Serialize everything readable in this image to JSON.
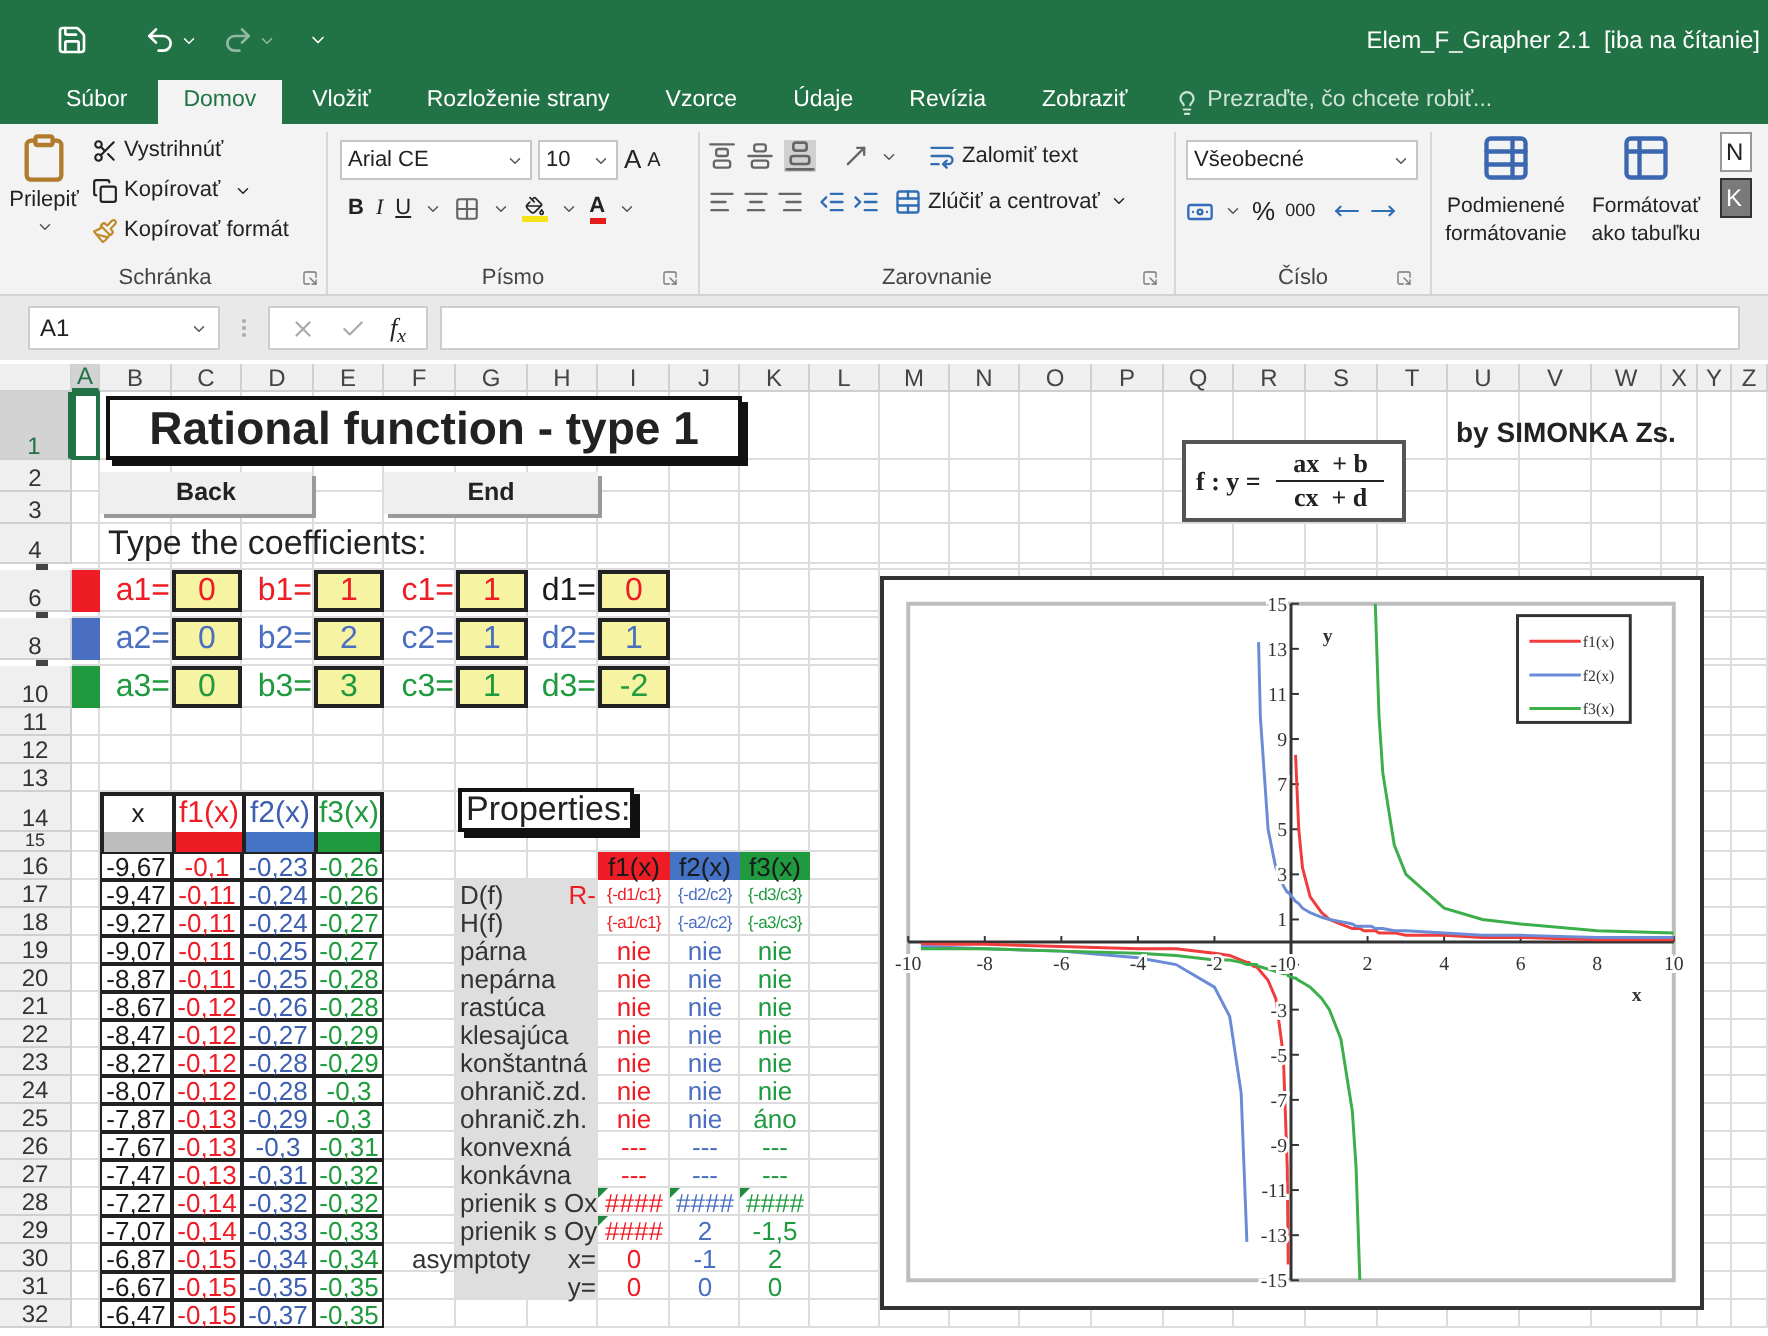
{
  "window": {
    "title": "Elem_F_Grapher 2.1  [iba na čítanie]"
  },
  "ribbon_tabs": [
    {
      "label": "Súbor",
      "selected": false
    },
    {
      "label": "Domov",
      "selected": true
    },
    {
      "label": "Vložiť",
      "selected": false
    },
    {
      "label": "Rozloženie strany",
      "selected": false
    },
    {
      "label": "Vzorce",
      "selected": false
    },
    {
      "label": "Údaje",
      "selected": false
    },
    {
      "label": "Revízia",
      "selected": false
    },
    {
      "label": "Zobraziť",
      "selected": false
    }
  ],
  "tell_me": {
    "placeholder": "Prezraďte, čo chcete robiť..."
  },
  "clipboard": {
    "label": "Schránka",
    "paste": "Prilepiť",
    "cut": "Vystrihnúť",
    "copy": "Kopírovať",
    "format_painter": "Kopírovať formát"
  },
  "font": {
    "label": "Písmo",
    "name": "Arial CE",
    "size": "10",
    "grow": "A",
    "shrink": "A",
    "bold": "B",
    "italic": "I",
    "underline": "U",
    "font_color": "A"
  },
  "alignment": {
    "label": "Zarovnanie",
    "wrap_text": "Zalomiť text",
    "merge": "Zlúčiť a centrovať"
  },
  "number": {
    "label": "Číslo",
    "format": "Všeobecné",
    "percent": "%",
    "thousands": "000"
  },
  "styles": {
    "conditional": "Podmienené formátovanie",
    "as_table": "Formátovať ako tabuľku",
    "style_1": "N",
    "style_2": "K"
  },
  "formula_bar": {
    "name_box": "A1",
    "fx": "f$_{x}$"
  },
  "sheet": {
    "columns": [
      {
        "label": "A",
        "selected": true
      },
      {
        "label": "B",
        "selected": false
      },
      {
        "label": "C",
        "selected": false
      },
      {
        "label": "D",
        "selected": false
      },
      {
        "label": "E",
        "selected": false
      },
      {
        "label": "F",
        "selected": false
      },
      {
        "label": "G",
        "selected": false
      },
      {
        "label": "H",
        "selected": false
      },
      {
        "label": "I",
        "selected": false
      },
      {
        "label": "J",
        "selected": false
      },
      {
        "label": "K",
        "selected": false
      },
      {
        "label": "L",
        "selected": false
      },
      {
        "label": "M",
        "selected": false
      },
      {
        "label": "N",
        "selected": false
      },
      {
        "label": "O",
        "selected": false
      },
      {
        "label": "P",
        "selected": false
      },
      {
        "label": "Q",
        "selected": false
      },
      {
        "label": "R",
        "selected": false
      },
      {
        "label": "S",
        "selected": false
      },
      {
        "label": "T",
        "selected": false
      },
      {
        "label": "U",
        "selected": false
      },
      {
        "label": "V",
        "selected": false
      },
      {
        "label": "W",
        "selected": false
      },
      {
        "label": "X",
        "selected": false
      },
      {
        "label": "Y",
        "selected": false
      },
      {
        "label": "Z",
        "selected": false
      }
    ],
    "rows": [
      {
        "label": "1",
        "selected": true,
        "collapsed": false
      },
      {
        "label": "2",
        "selected": false,
        "collapsed": false
      },
      {
        "label": "3",
        "selected": false,
        "collapsed": false
      },
      {
        "label": "4",
        "selected": false,
        "collapsed": false
      },
      {
        "selected": false,
        "collapsed": true
      },
      {
        "label": "6",
        "selected": false,
        "collapsed": false
      },
      {
        "selected": false,
        "collapsed": true
      },
      {
        "label": "8",
        "selected": false,
        "collapsed": false
      },
      {
        "selected": false,
        "collapsed": true
      },
      {
        "label": "10",
        "selected": false,
        "collapsed": false
      },
      {
        "label": "11",
        "selected": false,
        "collapsed": false
      },
      {
        "label": "12",
        "selected": false,
        "collapsed": false
      },
      {
        "label": "13",
        "selected": false,
        "collapsed": false
      },
      {
        "label": "14",
        "selected": false,
        "collapsed": false
      },
      {
        "label": "15",
        "selected": false,
        "collapsed": false
      },
      {
        "label": "16",
        "selected": false,
        "collapsed": false
      },
      {
        "label": "17",
        "selected": false,
        "collapsed": false
      },
      {
        "label": "18",
        "selected": false,
        "collapsed": false
      },
      {
        "label": "19",
        "selected": false,
        "collapsed": false
      },
      {
        "label": "20",
        "selected": false,
        "collapsed": false
      },
      {
        "label": "21",
        "selected": false,
        "collapsed": false
      },
      {
        "label": "22",
        "selected": false,
        "collapsed": false
      },
      {
        "label": "23",
        "selected": false,
        "collapsed": false
      },
      {
        "label": "24",
        "selected": false,
        "collapsed": false
      },
      {
        "label": "25",
        "selected": false,
        "collapsed": false
      },
      {
        "label": "26",
        "selected": false,
        "collapsed": false
      },
      {
        "label": "27",
        "selected": false,
        "collapsed": false
      },
      {
        "label": "28",
        "selected": false,
        "collapsed": false
      },
      {
        "label": "29",
        "selected": false,
        "collapsed": false
      },
      {
        "label": "30",
        "selected": false,
        "collapsed": false
      },
      {
        "label": "31",
        "selected": false,
        "collapsed": false
      },
      {
        "label": "32",
        "selected": false,
        "collapsed": false
      }
    ]
  },
  "title": "Rational function - type 1",
  "buttons": [
    "Back",
    "End"
  ],
  "prompt": "Type the coefficients:",
  "functions": [
    {
      "color": "#ee1c25",
      "terms": [
        {
          "label": "a1=",
          "value": "0"
        },
        {
          "label": "b1=",
          "value": "1"
        },
        {
          "label": "c1=",
          "value": "1"
        },
        {
          "label": "d1=",
          "value": "0",
          "color": "#1a1a1a"
        }
      ]
    },
    {
      "color": "#4a6fc0",
      "terms": [
        {
          "label": "a2=",
          "value": "0"
        },
        {
          "label": "b2=",
          "value": "2"
        },
        {
          "label": "c2=",
          "value": "1"
        },
        {
          "label": "d2=",
          "value": "1"
        }
      ]
    },
    {
      "color": "#1f9a3e",
      "terms": [
        {
          "label": "a3=",
          "value": "0"
        },
        {
          "label": "b3=",
          "value": "3"
        },
        {
          "label": "c3=",
          "value": "1"
        },
        {
          "label": "d3=",
          "value": "-2"
        }
      ]
    }
  ],
  "formula": {
    "lhs": "f : y =",
    "numerator": "ax  + b",
    "denominator": "cx  + d"
  },
  "author": "by SIMONKA Zs.",
  "table": {
    "columns": [
      {
        "label": "x",
        "color": "#1a1a1a"
      },
      {
        "label": "f1(x)",
        "color": "#ee1c25"
      },
      {
        "label": "f2(x)",
        "color": "#3d5fb0"
      },
      {
        "label": "f3(x)",
        "color": "#1f9a3e"
      }
    ],
    "header_bars": [
      {
        "color": "#bdbdbd"
      },
      {
        "color": "#ee1c25"
      },
      {
        "color": "#4472c4"
      },
      {
        "color": "#1f9a3e"
      }
    ],
    "rows": [
      [
        "-9,67",
        "-0,1",
        "-0,23",
        "-0,26"
      ],
      [
        "-9,47",
        "-0,11",
        "-0,24",
        "-0,26"
      ],
      [
        "-9,27",
        "-0,11",
        "-0,24",
        "-0,27"
      ],
      [
        "-9,07",
        "-0,11",
        "-0,25",
        "-0,27"
      ],
      [
        "-8,87",
        "-0,11",
        "-0,25",
        "-0,28"
      ],
      [
        "-8,67",
        "-0,12",
        "-0,26",
        "-0,28"
      ],
      [
        "-8,47",
        "-0,12",
        "-0,27",
        "-0,29"
      ],
      [
        "-8,27",
        "-0,12",
        "-0,28",
        "-0,29"
      ],
      [
        "-8,07",
        "-0,12",
        "-0,28",
        "-0,3"
      ],
      [
        "-7,87",
        "-0,13",
        "-0,29",
        "-0,3"
      ],
      [
        "-7,67",
        "-0,13",
        "-0,3",
        "-0,31"
      ],
      [
        "-7,47",
        "-0,13",
        "-0,31",
        "-0,32"
      ],
      [
        "-7,27",
        "-0,14",
        "-0,32",
        "-0,32"
      ],
      [
        "-7,07",
        "-0,14",
        "-0,33",
        "-0,33"
      ],
      [
        "-6,87",
        "-0,15",
        "-0,34",
        "-0,34"
      ],
      [
        "-6,67",
        "-0,15",
        "-0,35",
        "-0,35"
      ],
      [
        "-6,47",
        "-0,15",
        "-0,37",
        "-0,35"
      ]
    ]
  },
  "properties": {
    "title": "Properties:",
    "headers": [
      {
        "label": "f1(x)",
        "color": "#ee1c25"
      },
      {
        "label": "f2(x)",
        "color": "#4472c4"
      },
      {
        "label": "f3(x)",
        "color": "#1f9a3e"
      }
    ],
    "rows": [
      {
        "kind": "formula",
        "label": "D(f)",
        "suffix": "R-",
        "values": [
          "{-d1/c1}",
          "{-d2/c2}",
          "{-d3/c3}"
        ]
      },
      {
        "kind": "formula",
        "label": "H(f)",
        "values": [
          "{-a1/c1}",
          "{-a2/c2}",
          "{-a3/c3}"
        ]
      },
      {
        "kind": "value",
        "label": "párna",
        "values": [
          "nie",
          "nie",
          "nie"
        ]
      },
      {
        "kind": "value",
        "label": "nepárna",
        "values": [
          "nie",
          "nie",
          "nie"
        ]
      },
      {
        "kind": "value",
        "label": "rastúca",
        "values": [
          "nie",
          "nie",
          "nie"
        ]
      },
      {
        "kind": "value",
        "label": "klesajúca",
        "values": [
          "nie",
          "nie",
          "nie"
        ]
      },
      {
        "kind": "value",
        "label": "konštantná",
        "values": [
          "nie",
          "nie",
          "nie"
        ]
      },
      {
        "kind": "value",
        "label": "ohranič.zd.",
        "values": [
          "nie",
          "nie",
          "nie"
        ]
      },
      {
        "kind": "value",
        "label": "ohranič.zh.",
        "values": [
          "nie",
          "nie",
          "áno"
        ]
      },
      {
        "kind": "value",
        "label": "konvexná",
        "values": [
          "---",
          "---",
          "---"
        ]
      },
      {
        "kind": "value",
        "label": "konkávna",
        "values": [
          "---",
          "---",
          "---"
        ]
      },
      {
        "kind": "value",
        "label": "prienik s Ox",
        "values": [
          "####",
          "####",
          "####"
        ],
        "flags": [
          true,
          true,
          true
        ]
      },
      {
        "kind": "value",
        "label": "prienik s Oy",
        "values": [
          "####",
          "2",
          "-1,5"
        ],
        "flags": [
          true,
          false,
          false
        ]
      },
      {
        "kind": "asymptote",
        "label": "asymptoty",
        "suffix": "x=",
        "values": [
          "0",
          "-1",
          "2"
        ]
      },
      {
        "kind": "value",
        "suffix": "y=",
        "values": [
          "0",
          "0",
          "0"
        ]
      }
    ]
  },
  "chart": {
    "chart_data": {
      "type": "line",
      "xlabel": "x",
      "ylabel": "y",
      "legend": "upper right",
      "xlim": [
        -10,
        10
      ],
      "ylim": [
        -15,
        15
      ],
      "xticks": [
        -10,
        -8,
        -6,
        -4,
        -2,
        0,
        2,
        4,
        6,
        8,
        10
      ],
      "yticks": [
        -15,
        -13,
        -11,
        -9,
        -7,
        -5,
        -3,
        -1,
        1,
        3,
        5,
        7,
        9,
        11,
        13,
        15
      ],
      "x": [
        -9.67,
        -8,
        -6,
        -4,
        -3,
        -2,
        -1.6,
        -1.3,
        -1.15,
        -1.1,
        -1.05,
        -0.95,
        -0.9,
        -0.85,
        -0.8,
        -0.6,
        -0.4,
        -0.2,
        -0.1,
        -0.07,
        0.07,
        0.12,
        0.2,
        0.3,
        0.5,
        0.8,
        1,
        1.3,
        1.6,
        1.7,
        1.8,
        1.9,
        1.95,
        2.05,
        2.1,
        2.2,
        2.3,
        2.4,
        2.7,
        3,
        4,
        5,
        6,
        8,
        10
      ],
      "series": [
        {
          "name": "f1(x)",
          "color": "#f03c3c",
          "values": [
            -0.1,
            -0.1,
            -0.2,
            -0.3,
            -0.3,
            -0.5,
            -0.6,
            -0.8,
            -0.9,
            -0.9,
            -1,
            -1.1,
            -1.1,
            -1.2,
            -1.3,
            -1.7,
            -2.5,
            -5,
            -10,
            -14.3,
            null,
            8.3,
            5,
            3.3,
            2,
            1.3,
            1,
            0.8,
            0.6,
            0.6,
            0.6,
            0.5,
            0.5,
            0.5,
            0.5,
            0.5,
            0.4,
            0.4,
            0.4,
            0.3,
            0.3,
            0.2,
            0.2,
            0.1,
            0.1
          ]
        },
        {
          "name": "f2(x)",
          "color": "#6b8bd6",
          "values": [
            -0.2,
            -0.3,
            -0.4,
            -0.7,
            -1,
            -2,
            -3.3,
            -6.7,
            -13.3,
            null,
            null,
            null,
            null,
            13.3,
            10,
            5,
            3.3,
            2.5,
            2.2,
            2.2,
            1.9,
            1.8,
            1.7,
            1.5,
            1.3,
            1.1,
            1,
            0.9,
            0.8,
            0.7,
            0.7,
            0.7,
            0.7,
            0.7,
            0.7,
            0.6,
            0.6,
            0.6,
            0.5,
            0.5,
            0.4,
            0.3,
            0.3,
            0.2,
            0.2
          ]
        },
        {
          "name": "f3(x)",
          "color": "#3cae4a",
          "values": [
            -0.3,
            -0.3,
            -0.4,
            -0.5,
            -0.6,
            -0.8,
            -0.8,
            -0.9,
            -1,
            -1,
            -1,
            -1,
            -1,
            -1.1,
            -1.1,
            -1.2,
            -1.3,
            -1.4,
            -1.4,
            -1.5,
            -1.6,
            -1.6,
            -1.7,
            -1.8,
            -2,
            -2.5,
            -3,
            -4.3,
            -7.5,
            -10,
            -15,
            null,
            null,
            null,
            null,
            15,
            10,
            7.5,
            4.3,
            3,
            1.5,
            1,
            0.8,
            0.5,
            0.4
          ]
        }
      ]
    }
  }
}
